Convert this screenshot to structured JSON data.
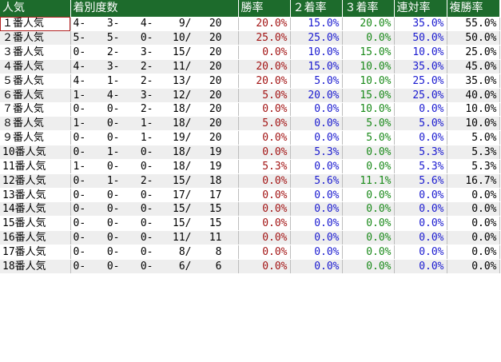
{
  "headers": {
    "rank": "人気",
    "record": "着別度数",
    "win": "勝率",
    "second": "２着率",
    "third": "３着率",
    "rentai": "連対率",
    "fukusho": "複勝率"
  },
  "rows": [
    {
      "rank": "１番人気",
      "r1": "4-",
      "r2": "3-",
      "r3": "4-",
      "r4": "9/",
      "r5": "20",
      "win": "20.0%",
      "second": "15.0%",
      "third": "20.0%",
      "rentai": "35.0%",
      "fukusho": "55.0%"
    },
    {
      "rank": "２番人気",
      "r1": "5-",
      "r2": "5-",
      "r3": "0-",
      "r4": "10/",
      "r5": "20",
      "win": "25.0%",
      "second": "25.0%",
      "third": "0.0%",
      "rentai": "50.0%",
      "fukusho": "50.0%"
    },
    {
      "rank": "３番人気",
      "r1": "0-",
      "r2": "2-",
      "r3": "3-",
      "r4": "15/",
      "r5": "20",
      "win": "0.0%",
      "second": "10.0%",
      "third": "15.0%",
      "rentai": "10.0%",
      "fukusho": "25.0%"
    },
    {
      "rank": "４番人気",
      "r1": "4-",
      "r2": "3-",
      "r3": "2-",
      "r4": "11/",
      "r5": "20",
      "win": "20.0%",
      "second": "15.0%",
      "third": "10.0%",
      "rentai": "35.0%",
      "fukusho": "45.0%"
    },
    {
      "rank": "５番人気",
      "r1": "4-",
      "r2": "1-",
      "r3": "2-",
      "r4": "13/",
      "r5": "20",
      "win": "20.0%",
      "second": "5.0%",
      "third": "10.0%",
      "rentai": "25.0%",
      "fukusho": "35.0%"
    },
    {
      "rank": "６番人気",
      "r1": "1-",
      "r2": "4-",
      "r3": "3-",
      "r4": "12/",
      "r5": "20",
      "win": "5.0%",
      "second": "20.0%",
      "third": "15.0%",
      "rentai": "25.0%",
      "fukusho": "40.0%"
    },
    {
      "rank": "７番人気",
      "r1": "0-",
      "r2": "0-",
      "r3": "2-",
      "r4": "18/",
      "r5": "20",
      "win": "0.0%",
      "second": "0.0%",
      "third": "10.0%",
      "rentai": "0.0%",
      "fukusho": "10.0%"
    },
    {
      "rank": "８番人気",
      "r1": "1-",
      "r2": "0-",
      "r3": "1-",
      "r4": "18/",
      "r5": "20",
      "win": "5.0%",
      "second": "0.0%",
      "third": "5.0%",
      "rentai": "5.0%",
      "fukusho": "10.0%"
    },
    {
      "rank": "９番人気",
      "r1": "0-",
      "r2": "0-",
      "r3": "1-",
      "r4": "19/",
      "r5": "20",
      "win": "0.0%",
      "second": "0.0%",
      "third": "5.0%",
      "rentai": "0.0%",
      "fukusho": "5.0%"
    },
    {
      "rank": "10番人気",
      "r1": "0-",
      "r2": "1-",
      "r3": "0-",
      "r4": "18/",
      "r5": "19",
      "win": "0.0%",
      "second": "5.3%",
      "third": "0.0%",
      "rentai": "5.3%",
      "fukusho": "5.3%"
    },
    {
      "rank": "11番人気",
      "r1": "1-",
      "r2": "0-",
      "r3": "0-",
      "r4": "18/",
      "r5": "19",
      "win": "5.3%",
      "second": "0.0%",
      "third": "0.0%",
      "rentai": "5.3%",
      "fukusho": "5.3%"
    },
    {
      "rank": "12番人気",
      "r1": "0-",
      "r2": "1-",
      "r3": "2-",
      "r4": "15/",
      "r5": "18",
      "win": "0.0%",
      "second": "5.6%",
      "third": "11.1%",
      "rentai": "5.6%",
      "fukusho": "16.7%"
    },
    {
      "rank": "13番人気",
      "r1": "0-",
      "r2": "0-",
      "r3": "0-",
      "r4": "17/",
      "r5": "17",
      "win": "0.0%",
      "second": "0.0%",
      "third": "0.0%",
      "rentai": "0.0%",
      "fukusho": "0.0%"
    },
    {
      "rank": "14番人気",
      "r1": "0-",
      "r2": "0-",
      "r3": "0-",
      "r4": "15/",
      "r5": "15",
      "win": "0.0%",
      "second": "0.0%",
      "third": "0.0%",
      "rentai": "0.0%",
      "fukusho": "0.0%"
    },
    {
      "rank": "15番人気",
      "r1": "0-",
      "r2": "0-",
      "r3": "0-",
      "r4": "15/",
      "r5": "15",
      "win": "0.0%",
      "second": "0.0%",
      "third": "0.0%",
      "rentai": "0.0%",
      "fukusho": "0.0%"
    },
    {
      "rank": "16番人気",
      "r1": "0-",
      "r2": "0-",
      "r3": "0-",
      "r4": "11/",
      "r5": "11",
      "win": "0.0%",
      "second": "0.0%",
      "third": "0.0%",
      "rentai": "0.0%",
      "fukusho": "0.0%"
    },
    {
      "rank": "17番人気",
      "r1": "0-",
      "r2": "0-",
      "r3": "0-",
      "r4": "8/",
      "r5": "8",
      "win": "0.0%",
      "second": "0.0%",
      "third": "0.0%",
      "rentai": "0.0%",
      "fukusho": "0.0%"
    },
    {
      "rank": "18番人気",
      "r1": "0-",
      "r2": "0-",
      "r3": "0-",
      "r4": "6/",
      "r5": "6",
      "win": "0.0%",
      "second": "0.0%",
      "third": "0.0%",
      "rentai": "0.0%",
      "fukusho": "0.0%"
    }
  ],
  "colors": {
    "header_bg": "#1d6b2c",
    "win": "#a31515",
    "second": "#1a1ad0",
    "third": "#1a8a1a",
    "rentai": "#1a1ad0",
    "fukusho": "#000000"
  },
  "selected_cell": "１番人気"
}
